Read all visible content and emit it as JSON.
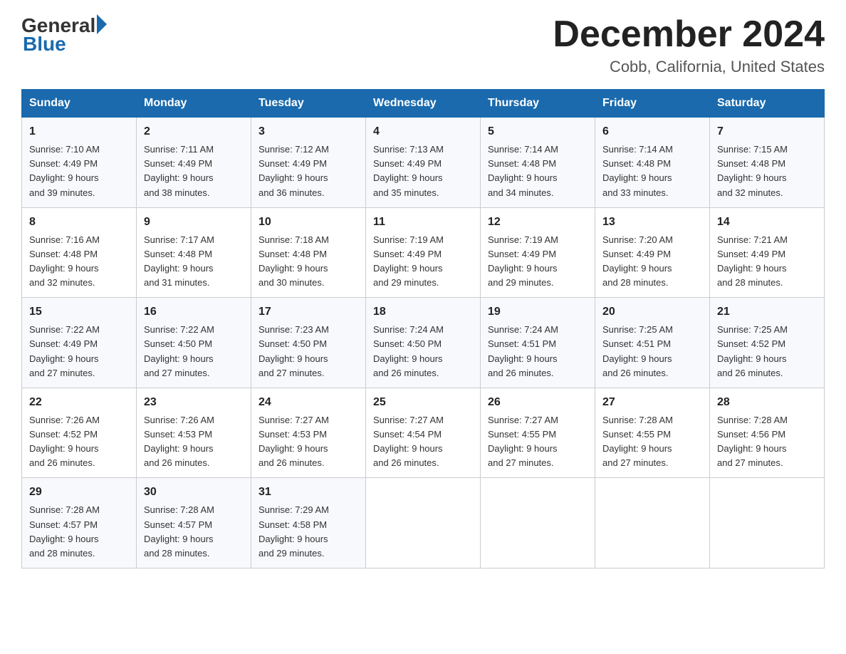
{
  "header": {
    "logo_general": "General",
    "logo_blue": "Blue",
    "month_title": "December 2024",
    "location": "Cobb, California, United States"
  },
  "days_of_week": [
    "Sunday",
    "Monday",
    "Tuesday",
    "Wednesday",
    "Thursday",
    "Friday",
    "Saturday"
  ],
  "weeks": [
    [
      {
        "day": "1",
        "sunrise": "7:10 AM",
        "sunset": "4:49 PM",
        "daylight": "9 hours and 39 minutes."
      },
      {
        "day": "2",
        "sunrise": "7:11 AM",
        "sunset": "4:49 PM",
        "daylight": "9 hours and 38 minutes."
      },
      {
        "day": "3",
        "sunrise": "7:12 AM",
        "sunset": "4:49 PM",
        "daylight": "9 hours and 36 minutes."
      },
      {
        "day": "4",
        "sunrise": "7:13 AM",
        "sunset": "4:49 PM",
        "daylight": "9 hours and 35 minutes."
      },
      {
        "day": "5",
        "sunrise": "7:14 AM",
        "sunset": "4:48 PM",
        "daylight": "9 hours and 34 minutes."
      },
      {
        "day": "6",
        "sunrise": "7:14 AM",
        "sunset": "4:48 PM",
        "daylight": "9 hours and 33 minutes."
      },
      {
        "day": "7",
        "sunrise": "7:15 AM",
        "sunset": "4:48 PM",
        "daylight": "9 hours and 32 minutes."
      }
    ],
    [
      {
        "day": "8",
        "sunrise": "7:16 AM",
        "sunset": "4:48 PM",
        "daylight": "9 hours and 32 minutes."
      },
      {
        "day": "9",
        "sunrise": "7:17 AM",
        "sunset": "4:48 PM",
        "daylight": "9 hours and 31 minutes."
      },
      {
        "day": "10",
        "sunrise": "7:18 AM",
        "sunset": "4:48 PM",
        "daylight": "9 hours and 30 minutes."
      },
      {
        "day": "11",
        "sunrise": "7:19 AM",
        "sunset": "4:49 PM",
        "daylight": "9 hours and 29 minutes."
      },
      {
        "day": "12",
        "sunrise": "7:19 AM",
        "sunset": "4:49 PM",
        "daylight": "9 hours and 29 minutes."
      },
      {
        "day": "13",
        "sunrise": "7:20 AM",
        "sunset": "4:49 PM",
        "daylight": "9 hours and 28 minutes."
      },
      {
        "day": "14",
        "sunrise": "7:21 AM",
        "sunset": "4:49 PM",
        "daylight": "9 hours and 28 minutes."
      }
    ],
    [
      {
        "day": "15",
        "sunrise": "7:22 AM",
        "sunset": "4:49 PM",
        "daylight": "9 hours and 27 minutes."
      },
      {
        "day": "16",
        "sunrise": "7:22 AM",
        "sunset": "4:50 PM",
        "daylight": "9 hours and 27 minutes."
      },
      {
        "day": "17",
        "sunrise": "7:23 AM",
        "sunset": "4:50 PM",
        "daylight": "9 hours and 27 minutes."
      },
      {
        "day": "18",
        "sunrise": "7:24 AM",
        "sunset": "4:50 PM",
        "daylight": "9 hours and 26 minutes."
      },
      {
        "day": "19",
        "sunrise": "7:24 AM",
        "sunset": "4:51 PM",
        "daylight": "9 hours and 26 minutes."
      },
      {
        "day": "20",
        "sunrise": "7:25 AM",
        "sunset": "4:51 PM",
        "daylight": "9 hours and 26 minutes."
      },
      {
        "day": "21",
        "sunrise": "7:25 AM",
        "sunset": "4:52 PM",
        "daylight": "9 hours and 26 minutes."
      }
    ],
    [
      {
        "day": "22",
        "sunrise": "7:26 AM",
        "sunset": "4:52 PM",
        "daylight": "9 hours and 26 minutes."
      },
      {
        "day": "23",
        "sunrise": "7:26 AM",
        "sunset": "4:53 PM",
        "daylight": "9 hours and 26 minutes."
      },
      {
        "day": "24",
        "sunrise": "7:27 AM",
        "sunset": "4:53 PM",
        "daylight": "9 hours and 26 minutes."
      },
      {
        "day": "25",
        "sunrise": "7:27 AM",
        "sunset": "4:54 PM",
        "daylight": "9 hours and 26 minutes."
      },
      {
        "day": "26",
        "sunrise": "7:27 AM",
        "sunset": "4:55 PM",
        "daylight": "9 hours and 27 minutes."
      },
      {
        "day": "27",
        "sunrise": "7:28 AM",
        "sunset": "4:55 PM",
        "daylight": "9 hours and 27 minutes."
      },
      {
        "day": "28",
        "sunrise": "7:28 AM",
        "sunset": "4:56 PM",
        "daylight": "9 hours and 27 minutes."
      }
    ],
    [
      {
        "day": "29",
        "sunrise": "7:28 AM",
        "sunset": "4:57 PM",
        "daylight": "9 hours and 28 minutes."
      },
      {
        "day": "30",
        "sunrise": "7:28 AM",
        "sunset": "4:57 PM",
        "daylight": "9 hours and 28 minutes."
      },
      {
        "day": "31",
        "sunrise": "7:29 AM",
        "sunset": "4:58 PM",
        "daylight": "9 hours and 29 minutes."
      },
      null,
      null,
      null,
      null
    ]
  ]
}
